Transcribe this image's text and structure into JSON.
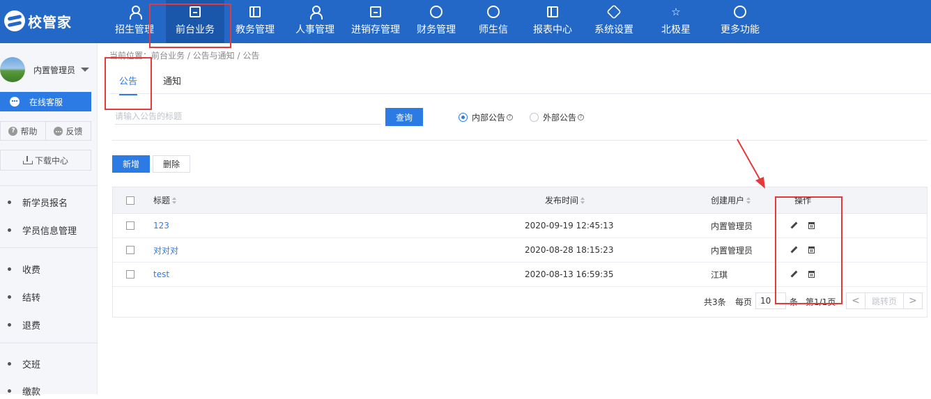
{
  "app": {
    "logo_text": "校管家"
  },
  "nav": [
    {
      "label": "招生管理",
      "icon": "add-user-icon"
    },
    {
      "label": "前台业务",
      "icon": "desktop-icon",
      "active": true
    },
    {
      "label": "教务管理",
      "icon": "book-icon"
    },
    {
      "label": "人事管理",
      "icon": "person-icon"
    },
    {
      "label": "进销存管理",
      "icon": "inventory-icon"
    },
    {
      "label": "财务管理",
      "icon": "yuan-icon"
    },
    {
      "label": "师生信",
      "icon": "message-icon"
    },
    {
      "label": "报表中心",
      "icon": "report-icon"
    },
    {
      "label": "系统设置",
      "icon": "settings-icon"
    },
    {
      "label": "北极星",
      "icon": "star-icon"
    },
    {
      "label": "更多功能",
      "icon": "more-icon"
    }
  ],
  "sidebar": {
    "user_name": "内置管理员",
    "online_service": "在线客服",
    "help": "帮助",
    "feedback": "反馈",
    "download_center": "下载中心",
    "items": [
      "新学员报名",
      "学员信息管理",
      "收费",
      "结转",
      "退费",
      "交班",
      "缴款"
    ]
  },
  "breadcrumb": "当前位置：前台业务 / 公告与通知 / 公告",
  "tabs": [
    "公告",
    "通知"
  ],
  "search": {
    "placeholder": "请输入公告的标题",
    "value": "",
    "button": "查询"
  },
  "filters": {
    "internal": "内部公告",
    "external": "外部公告",
    "selected": "internal"
  },
  "actions": {
    "add": "新增",
    "delete": "删除"
  },
  "table": {
    "headers": {
      "title": "标题",
      "publish_time": "发布时间",
      "creator": "创建用户",
      "operation": "操作"
    },
    "rows": [
      {
        "title": "123",
        "time": "2020-09-19 12:45:13",
        "creator": "内置管理员"
      },
      {
        "title": "对对对",
        "time": "2020-08-28 18:15:23",
        "creator": "内置管理员"
      },
      {
        "title": "test",
        "time": "2020-08-13 16:59:35",
        "creator": "江琪"
      }
    ]
  },
  "pagination": {
    "total": "共3条",
    "per_page_label": "每页",
    "per_page_value": "10",
    "unit": "条",
    "page_info": "第1/1页",
    "jump": "跳转页",
    "prev": "<",
    "next": ">"
  },
  "colors": {
    "nav_bg": "#2368c6",
    "accent": "#2c7be5",
    "annotation": "#e33b3b"
  }
}
